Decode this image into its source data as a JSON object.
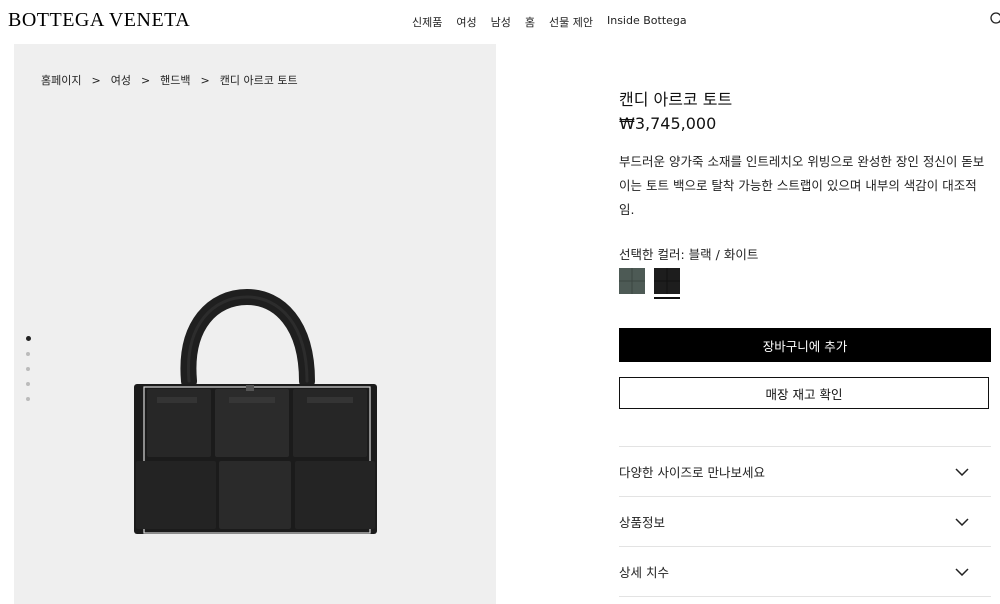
{
  "header": {
    "logo": "BOTTEGA VENETA",
    "nav": [
      "신제품",
      "여성",
      "남성",
      "홈",
      "선물 제안",
      "Inside Bottega"
    ]
  },
  "breadcrumb": [
    "홈페이지",
    "여성",
    "핸드백",
    "캔디 아르코 토트"
  ],
  "breadcrumb_separator": ">",
  "gallery": {
    "image_count": 5,
    "active_index": 0
  },
  "product": {
    "title": "캔디 아르코 토트",
    "price": "₩3,745,000",
    "description": "부드러운 양가죽 소재를 인트레치오 위빙으로 완성한 장인 정신이 돋보이는 토트 백으로 탈착 가능한 스트랩이 있으며 내부의 색감이 대조적임.",
    "color_label": "선택한 컬러: 블랙 / 화이트",
    "colors": [
      "#4d5a55",
      "#1d1d1d"
    ],
    "selected_color_index": 1
  },
  "buttons": {
    "add_to_cart": "장바구니에 추가",
    "check_stock": "매장 재고 확인"
  },
  "accordions": [
    "다양한 사이즈로 만나보세요",
    "상품정보",
    "상세 치수"
  ]
}
